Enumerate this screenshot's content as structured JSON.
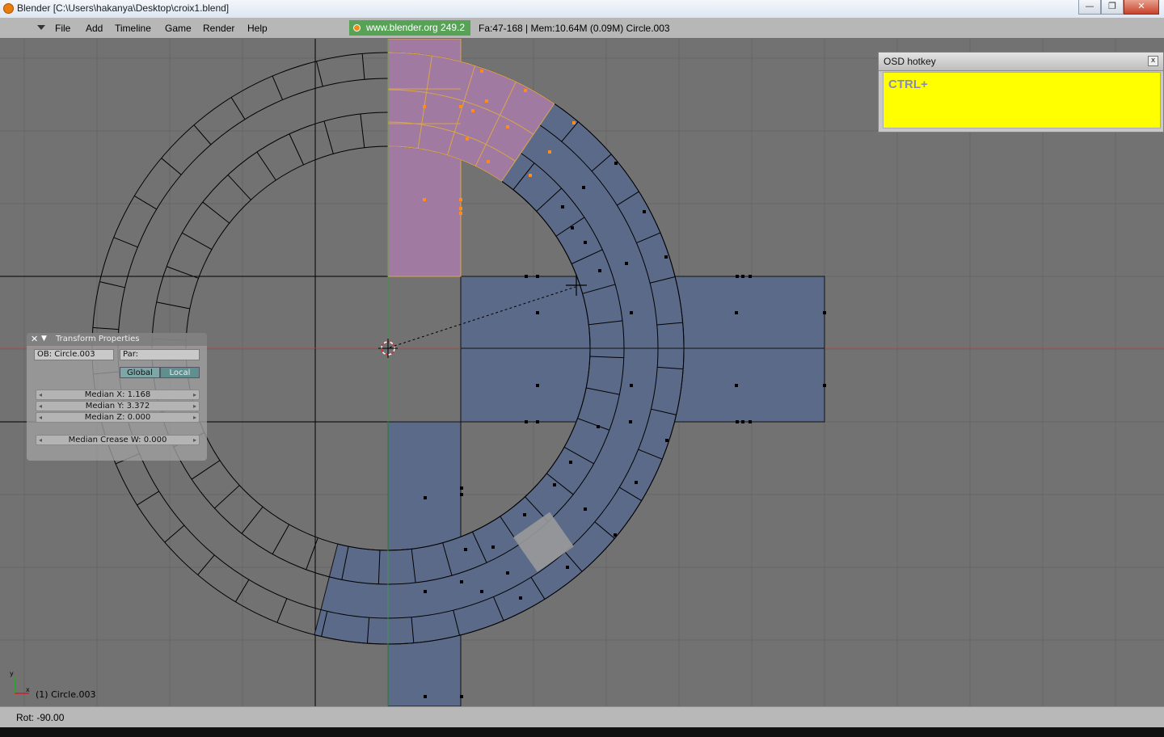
{
  "window": {
    "title": "Blender [C:\\Users\\hakanya\\Desktop\\croix1.blend]",
    "minimize_glyph": "—",
    "maximize_glyph": "❐",
    "close_glyph": "✕"
  },
  "menubar": {
    "items": [
      "File",
      "Add",
      "Timeline",
      "Game",
      "Render",
      "Help"
    ],
    "url": "www.blender.org 249.2",
    "stats": "Fa:47-168 | Mem:10.64M (0.09M) Circle.003"
  },
  "transform_panel": {
    "title": "Transform Properties",
    "close_glyph": "✕",
    "collapse_glyph": "▼",
    "object_field": "OB: Circle.003",
    "parent_field": "Par:",
    "global_label": "Global",
    "local_label": "Local",
    "median_x": "Median X: 1.168",
    "median_y": "Median Y: 3.372",
    "median_z": "Median Z: 0.000",
    "median_crease": "Median Crease W: 0.000"
  },
  "osd": {
    "title": "OSD hotkey",
    "close_glyph": "x",
    "hotkey": "CTRL+"
  },
  "viewport": {
    "axis_x": "x",
    "axis_y": "y",
    "object_label": "(1) Circle.003"
  },
  "statusbar": {
    "rotation": "Rot: -90.00"
  },
  "colors": {
    "viewport_bg": "#727272",
    "grid": "#666666",
    "selected_face": "#a07aa0",
    "unselected_face": "#5a6a88",
    "selected_vertex": "#ff8c1a",
    "url_badge": "#56a356",
    "osd_body": "#ffff00"
  }
}
